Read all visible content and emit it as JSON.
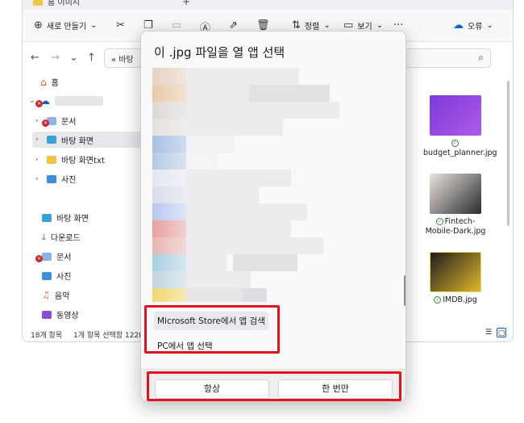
{
  "explorer": {
    "tab_title": "홈 이미지",
    "toolbar": {
      "new_label": "새로 만들기",
      "sort_label": "정렬",
      "view_label": "보기",
      "error_label": "오류"
    },
    "address": {
      "crumb": "« 바탕"
    },
    "sidebar": {
      "items": [
        {
          "label": "홈"
        },
        {
          "label": "문서"
        },
        {
          "label": "바탕 화면"
        },
        {
          "label": "바탕 화면txt"
        },
        {
          "label": "사진"
        },
        {
          "label": "바탕 화면"
        },
        {
          "label": "다운로드"
        },
        {
          "label": "문서"
        },
        {
          "label": "사진"
        },
        {
          "label": "음악"
        },
        {
          "label": "동영상"
        }
      ]
    },
    "status": {
      "items_count": "18개 항목",
      "selected": "1개 항목 선택함 122I"
    },
    "files": [
      {
        "name": "budget_planner.jpg"
      },
      {
        "name": "Fintech-Mobile-Dark.jpg"
      },
      {
        "name": "IMDB.jpg"
      }
    ]
  },
  "dialog": {
    "title": "이 .jpg 파일을 열 앱 선택",
    "store_link": "Microsoft Store에서 앱 검색",
    "pc_link": "PC에서 앱 선택",
    "always_button": "항상",
    "once_button": "한 번만"
  },
  "colors": {
    "highlight_border": "#e0141e",
    "accent": "#0067c0",
    "error_badge": "#d1242f"
  }
}
